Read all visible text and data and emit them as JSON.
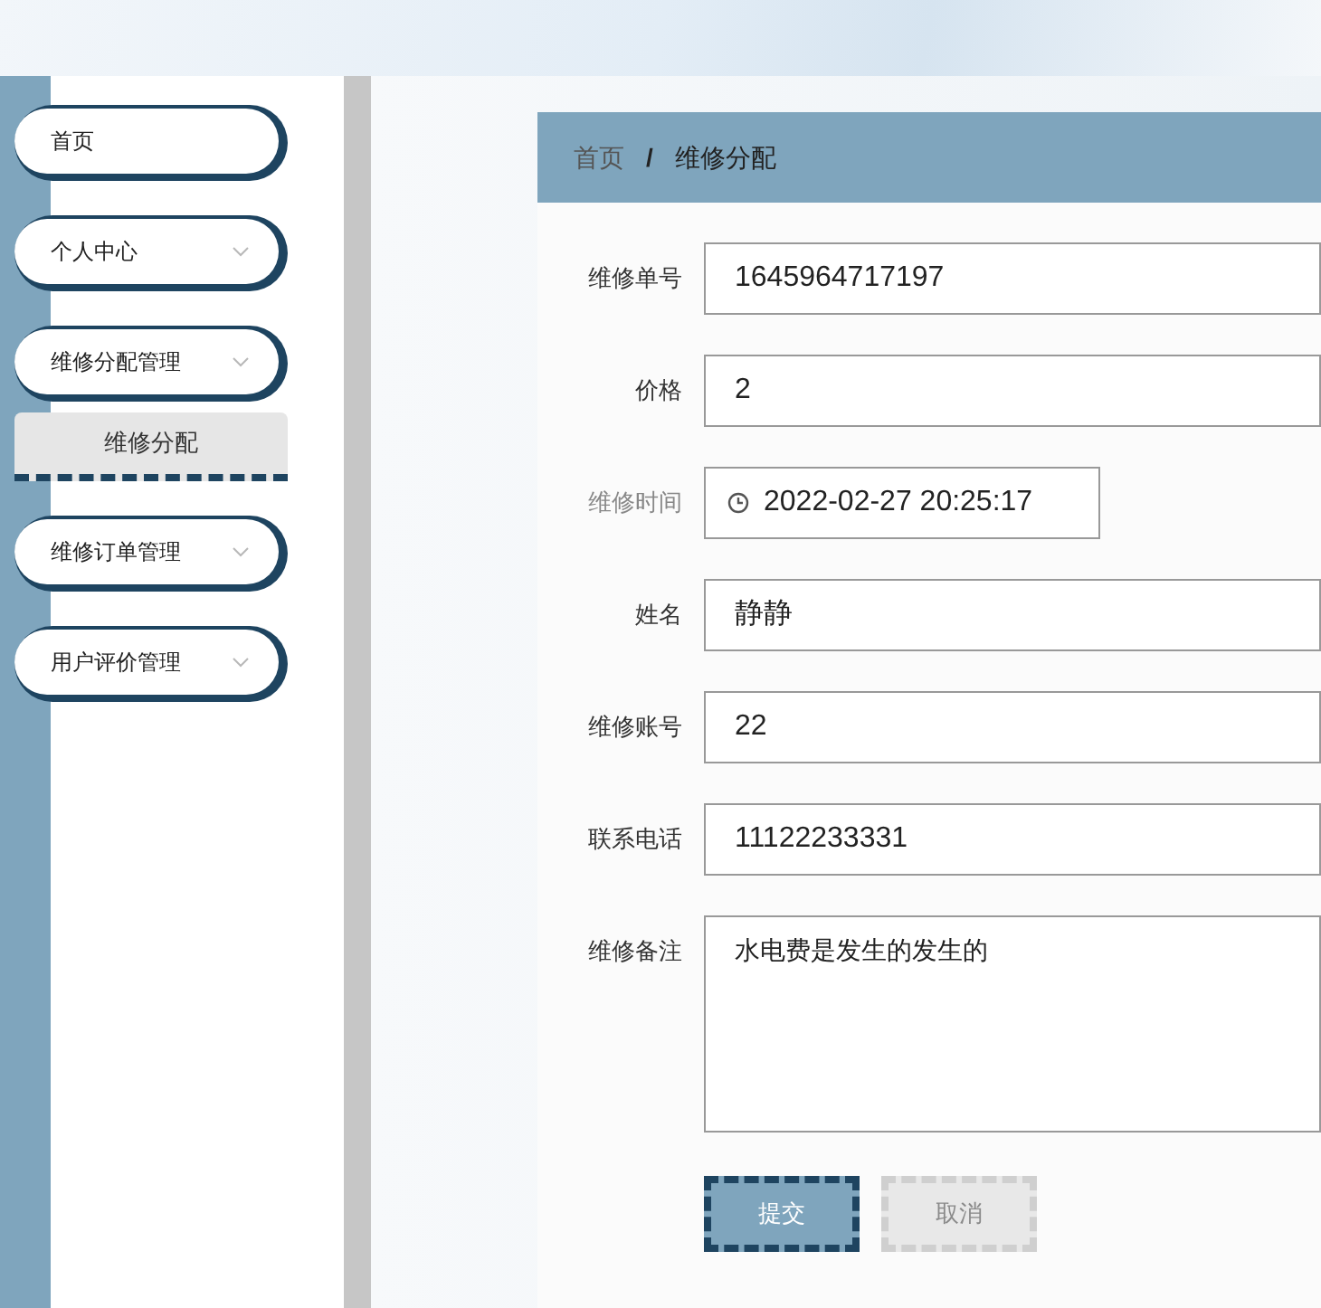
{
  "sidebar": {
    "items": [
      {
        "kind": "link",
        "label": "首页"
      },
      {
        "kind": "group",
        "label": "个人中心"
      },
      {
        "kind": "group",
        "label": "维修分配管理",
        "children": [
          {
            "label": "维修分配",
            "selected": true
          }
        ]
      },
      {
        "kind": "group",
        "label": "维修订单管理"
      },
      {
        "kind": "group",
        "label": "用户评价管理"
      }
    ]
  },
  "breadcrumb": [
    {
      "label": "首页"
    },
    {
      "label": "维修分配"
    }
  ],
  "breadcrumb_separator": "/",
  "form": {
    "fields": [
      {
        "kind": "text",
        "label": "维修单号",
        "value": "1645964717197"
      },
      {
        "kind": "text",
        "label": "价格",
        "value": "2"
      },
      {
        "kind": "datetime",
        "label": "维修时间",
        "value": "2022-02-27 20:25:17"
      },
      {
        "kind": "text",
        "label": "姓名",
        "value": "静静"
      },
      {
        "kind": "text",
        "label": "维修账号",
        "value": "22"
      },
      {
        "kind": "text",
        "label": "联系电话",
        "value": "11122233331"
      },
      {
        "kind": "textarea",
        "label": "维修备注",
        "value": "水电费是发生的发生的"
      }
    ],
    "buttons": [
      {
        "kind": "submit",
        "label": "提交"
      },
      {
        "kind": "cancel",
        "label": "取消"
      }
    ]
  }
}
